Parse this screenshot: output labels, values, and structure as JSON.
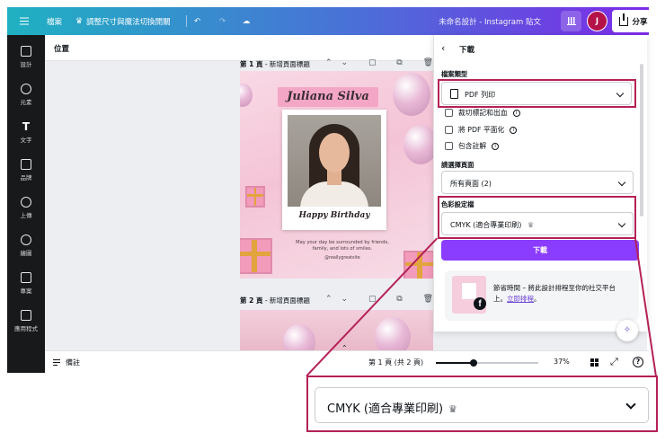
{
  "topbar": {
    "file": "檔案",
    "resize": "調整尺寸與魔法切換開關",
    "doc_title": "未命名設計 - Instagram 貼文",
    "avatar_initial": "J",
    "share": "分享"
  },
  "rail": {
    "items": [
      {
        "label": "設計",
        "icon": "layout-icon"
      },
      {
        "label": "元素",
        "icon": "shapes-icon"
      },
      {
        "label": "文字",
        "icon": "text-icon"
      },
      {
        "label": "品牌",
        "icon": "brand-icon"
      },
      {
        "label": "上傳",
        "icon": "upload-icon"
      },
      {
        "label": "繪圖",
        "icon": "draw-icon"
      },
      {
        "label": "專案",
        "icon": "folder-icon"
      },
      {
        "label": "應用程式",
        "icon": "apps-icon"
      }
    ]
  },
  "canvas": {
    "position_label": "位置",
    "page1_label": "第 1 頁 - 新增頁面標題",
    "page2_label": "第 2 頁 - 新增頁面標題",
    "page1_prefix": "第 1 頁",
    "page1_suffix": " - 新增頁面標題",
    "page2_prefix": "第 2 頁",
    "page2_suffix": " - 新增頁面標題"
  },
  "design": {
    "name": "Juliana Silva",
    "greeting": "Happy Birthday",
    "message": "May your day be surrounded by friends, family, and lots of smiles.",
    "handle": "@reallygreatsite"
  },
  "bottombar": {
    "notes": "備註",
    "page_indicator": "第 1 頁 (共 2 頁)",
    "zoom": "37%",
    "zoom_value": 0.37
  },
  "panel": {
    "title": "下載",
    "file_type_label": "檔案類型",
    "file_type_value": "PDF 列印",
    "options": [
      {
        "label": "裁切標記和出血",
        "checked": false
      },
      {
        "label": "將 PDF 平面化",
        "checked": false
      },
      {
        "label": "包含註解",
        "checked": false
      }
    ],
    "pages_label": "請選擇頁面",
    "pages_value": "所有頁面 (2)",
    "color_profile_label": "色彩設定檔",
    "color_profile_value": "CMYK (適合專業印刷)",
    "download_button": "下載",
    "promo_text": "節省時間 – 將此設計排程至你的社交平台上。",
    "promo_link": "立即排程",
    "promo_line1": "節省時間 – 將此設計排程至你的社交平台",
    "promo_line2_prefix": "上。",
    "promo_line2_suffix": "。"
  },
  "callout": {
    "value": "CMYK (適合專業印刷)",
    "accent_color": "#b42157"
  },
  "colors": {
    "accent": "#8b3dff",
    "rail_bg": "#18191b",
    "highlight": "#b42157"
  }
}
